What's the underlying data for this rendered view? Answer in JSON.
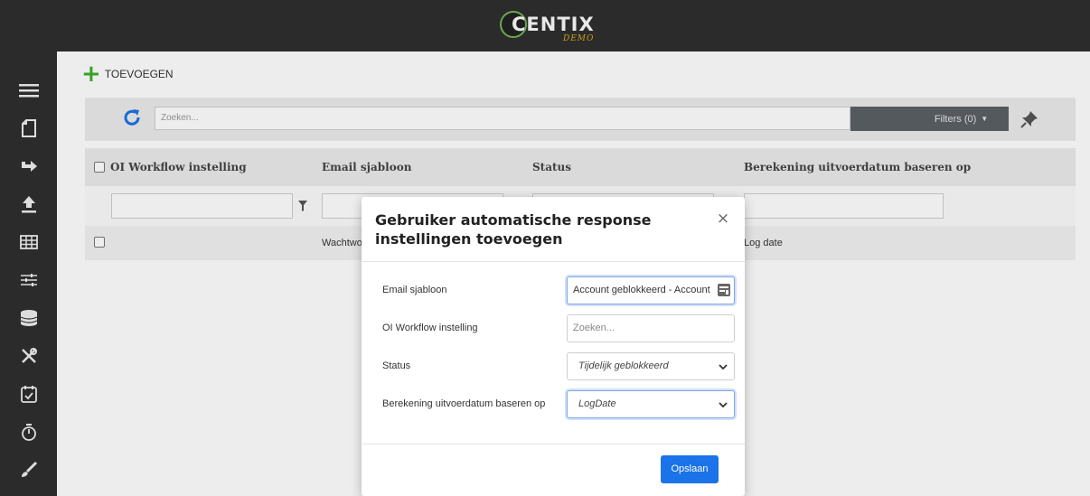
{
  "brand": {
    "name": "CENTIX",
    "subtitle": "DEMO"
  },
  "colors": {
    "accent": "#1a73e8",
    "topbar": "#2b2b2b",
    "add_green": "#3fae2a",
    "refresh_blue": "#1a73e8"
  },
  "sidebar": {
    "items": [
      {
        "icon": "hamburger-menu-icon"
      },
      {
        "icon": "document-icon"
      },
      {
        "icon": "redirect-arrow-icon"
      },
      {
        "icon": "upload-icon"
      },
      {
        "icon": "table-icon"
      },
      {
        "icon": "sliders-icon"
      },
      {
        "icon": "database-icon"
      },
      {
        "icon": "tools-icon"
      },
      {
        "icon": "calendar-check-icon"
      },
      {
        "icon": "stopwatch-icon"
      },
      {
        "icon": "paintbrush-icon"
      }
    ]
  },
  "toolbar": {
    "add_label": "TOEVOEGEN"
  },
  "search": {
    "placeholder": "Zoeken...",
    "filters_label": "Filters (0)"
  },
  "table": {
    "columns": [
      "OI Workflow instelling",
      "Email sjabloon",
      "Status",
      "Berekening uitvoerdatum baseren op"
    ],
    "rows": [
      {
        "workflow": "",
        "email": "Wachtwo",
        "status": "",
        "calc": "Log date"
      }
    ]
  },
  "modal": {
    "title": "Gebruiker automatische response instellingen toevoegen",
    "close_symbol": "×",
    "fields": {
      "email_label": "Email sjabloon",
      "email_value": "Account geblokkeerd - Account",
      "workflow_label": "OI Workflow instelling",
      "workflow_placeholder": "Zoeken...",
      "status_label": "Status",
      "status_value": "Tijdelijk geblokkeerd",
      "calc_label": "Berekening uitvoerdatum baseren op",
      "calc_value": "LogDate"
    },
    "save_label": "Opslaan"
  }
}
